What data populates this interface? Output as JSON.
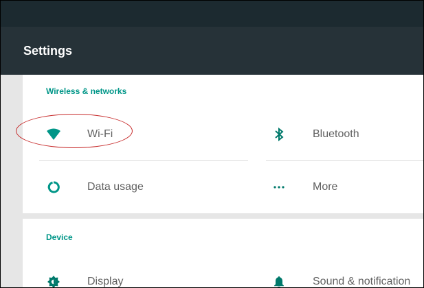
{
  "app_bar": {
    "title": "Settings"
  },
  "sections": {
    "wireless": {
      "header": "Wireless & networks",
      "items": {
        "wifi": "Wi-Fi",
        "bluetooth": "Bluetooth",
        "data_usage": "Data usage",
        "more": "More"
      }
    },
    "device": {
      "header": "Device",
      "items": {
        "display": "Display",
        "sound": "Sound & notification"
      }
    }
  },
  "colors": {
    "app_bar": "#263238",
    "status_bar": "#1c2a30",
    "accent": "#009688",
    "annotation": "#c62828"
  },
  "icons": {
    "wifi": "wifi-icon",
    "bluetooth": "bluetooth-icon",
    "data_usage": "data-usage-icon",
    "more": "more-icon",
    "display": "brightness-icon",
    "sound": "bell-icon"
  }
}
